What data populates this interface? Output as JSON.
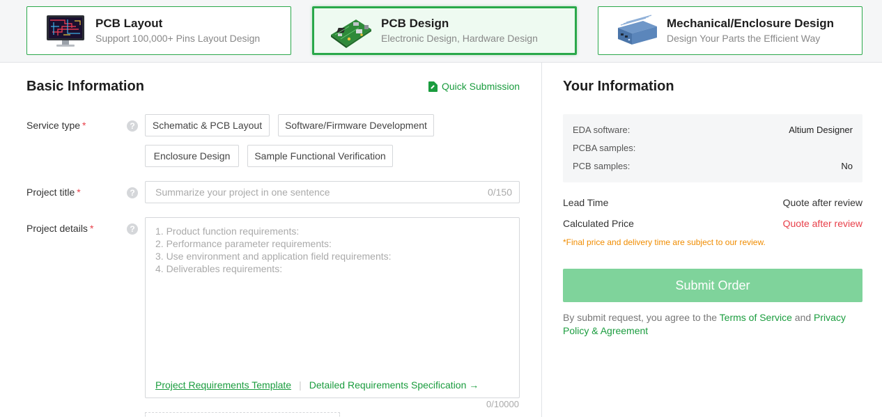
{
  "service_cards": [
    {
      "title": "PCB Layout",
      "subtitle": "Support 100,000+ Pins Layout Design",
      "image": "pcb-layout-monitor-image",
      "active": false
    },
    {
      "title": "PCB Design",
      "subtitle": "Electronic Design, Hardware Design",
      "image": "pcb-board-image",
      "active": true
    },
    {
      "title": "Mechanical/Enclosure Design",
      "subtitle": "Design Your Parts the Efficient Way",
      "image": "enclosure-box-image",
      "active": false
    }
  ],
  "basic": {
    "title": "Basic Information",
    "quick_submission": "Quick Submission",
    "service_type_label": "Service type",
    "required_mark": "*",
    "service_options": [
      "Schematic & PCB Layout",
      "Software/Firmware Development",
      "Enclosure Design",
      "Sample Functional Verification"
    ],
    "project_title_label": "Project title",
    "project_title_placeholder": "Summarize your project in one sentence",
    "project_title_count": "0/150",
    "project_details_label": "Project details",
    "project_details_placeholder": [
      "1. Product function requirements:",
      "2. Performance parameter requirements:",
      "3. Use environment and application field requirements:",
      "4. Deliverables requirements:"
    ],
    "template_link": "Project Requirements Template",
    "spec_link": "Detailed Requirements Specification →",
    "details_count": "0/10000",
    "help_glyph": "?"
  },
  "your_info": {
    "title": "Your Information",
    "rows": [
      {
        "label": "EDA software:",
        "value": "Altium Designer"
      },
      {
        "label": "PCBA samples:",
        "value": ""
      },
      {
        "label": "PCB samples:",
        "value": "No"
      }
    ],
    "lead_time_label": "Lead Time",
    "lead_time_value": "Quote after review",
    "price_label": "Calculated Price",
    "price_value": "Quote after review",
    "note": "*Final price and delivery time are subject to our review.",
    "submit_label": "Submit Order",
    "agree_prefix": "By submit request, you agree to the ",
    "terms_link": "Terms of Service",
    "agree_and": " and ",
    "privacy_link": "Privacy Policy & Agreement"
  },
  "colors": {
    "brand_green": "#1a9c3e",
    "submit_disabled": "#7fd39b",
    "required_red": "#e8404a",
    "note_orange": "#f08c00"
  }
}
